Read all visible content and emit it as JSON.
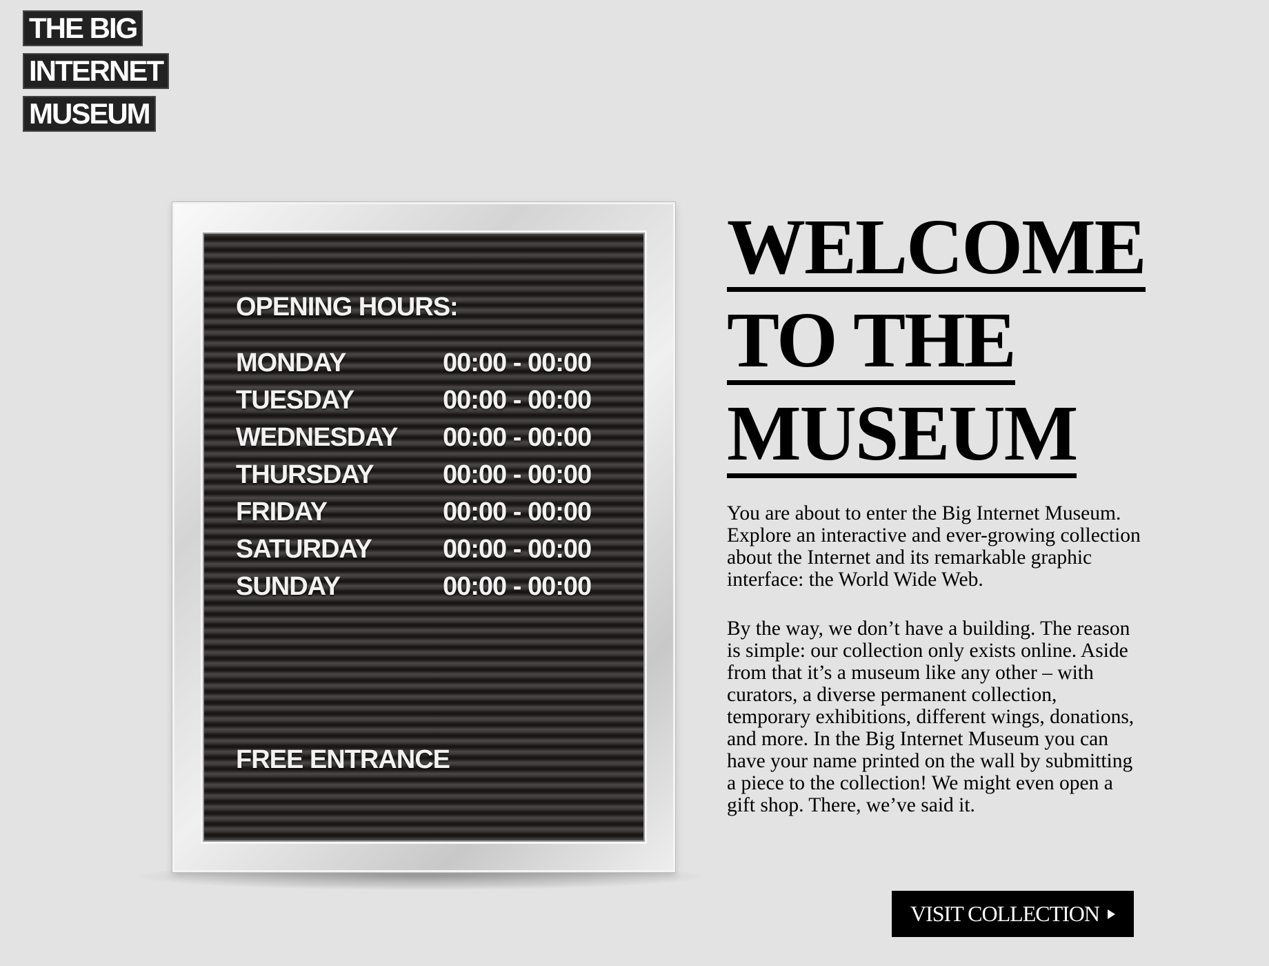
{
  "logo": {
    "lines": [
      "THE BIG",
      "INTERNET",
      "MUSEUM"
    ]
  },
  "board": {
    "title": "OPENING HOURS:",
    "hours": [
      {
        "day": "MONDAY",
        "time": "00:00 - 00:00"
      },
      {
        "day": "TUESDAY",
        "time": "00:00 - 00:00"
      },
      {
        "day": "WEDNESDAY",
        "time": "00:00 - 00:00"
      },
      {
        "day": "THURSDAY",
        "time": "00:00 - 00:00"
      },
      {
        "day": "FRIDAY",
        "time": "00:00 - 00:00"
      },
      {
        "day": "SATURDAY",
        "time": "00:00 - 00:00"
      },
      {
        "day": "SUNDAY",
        "time": "00:00 - 00:00"
      }
    ],
    "footer": "FREE ENTRANCE"
  },
  "welcome": {
    "lines": [
      "WELCOME",
      "TO THE",
      "MUSEUM"
    ]
  },
  "intro": {
    "paragraphs": [
      "You are about to enter the Big Internet Museum. Explore an interactive and ever-growing collection about the Internet and its remarkable graphic interface: the World Wide Web.",
      "By the way, we don’t have a building. The reason is simple: our collection only exists online. Aside from that it’s a museum like any other – with curators, a diverse permanent collection, temporary exhibitions, different wings, donations, and more. In the Big Internet Museum you can have your name printed on the wall by submitting a piece to the collection! We might even open a gift shop. There, we’ve said it."
    ]
  },
  "cta": {
    "label": "VISIT COLLECTION",
    "icon": "play-arrow-icon"
  },
  "colors": {
    "background": "#e3e3e3",
    "board": "#2a2827",
    "button": "#000000"
  }
}
